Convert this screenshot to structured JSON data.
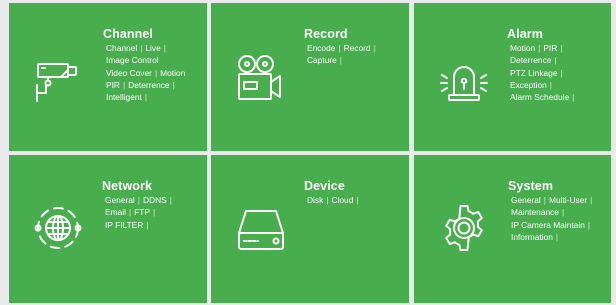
{
  "tiles": [
    {
      "key": "channel",
      "title": "Channel",
      "icon": "camera-icon",
      "lines": [
        [
          "Channel",
          "Live"
        ],
        [
          "Image Control"
        ],
        [
          "Video Cover",
          "Motion"
        ],
        [
          "PIR",
          "Deterrence"
        ],
        [
          "Intelligent"
        ]
      ]
    },
    {
      "key": "record",
      "title": "Record",
      "icon": "video-camera-icon",
      "lines": [
        [
          "Encode",
          "Record"
        ],
        [
          "Capture"
        ]
      ]
    },
    {
      "key": "alarm",
      "title": "Alarm",
      "icon": "alarm-light-icon",
      "lines": [
        [
          "Motion",
          "PIR"
        ],
        [
          "Deterrence"
        ],
        [
          "PTZ Linkage"
        ],
        [
          "Exception"
        ],
        [
          "Alarm Schedule"
        ]
      ]
    },
    {
      "key": "network",
      "title": "Network",
      "icon": "globe-icon",
      "lines": [
        [
          "General",
          "DDNS"
        ],
        [
          "Email",
          "FTP"
        ],
        [
          "IP FILTER"
        ]
      ]
    },
    {
      "key": "device",
      "title": "Device",
      "icon": "hard-drive-icon",
      "lines": [
        [
          "Disk",
          "Cloud"
        ]
      ]
    },
    {
      "key": "system",
      "title": "System",
      "icon": "gear-icon",
      "lines": [
        [
          "General",
          "Multi-User"
        ],
        [
          "Maintenance"
        ],
        [
          "IP Camera Maintain"
        ],
        [
          "Information"
        ]
      ]
    }
  ],
  "colors": {
    "tile": "#47ad4d",
    "background": "#e9eaec",
    "text": "#ffffff"
  }
}
